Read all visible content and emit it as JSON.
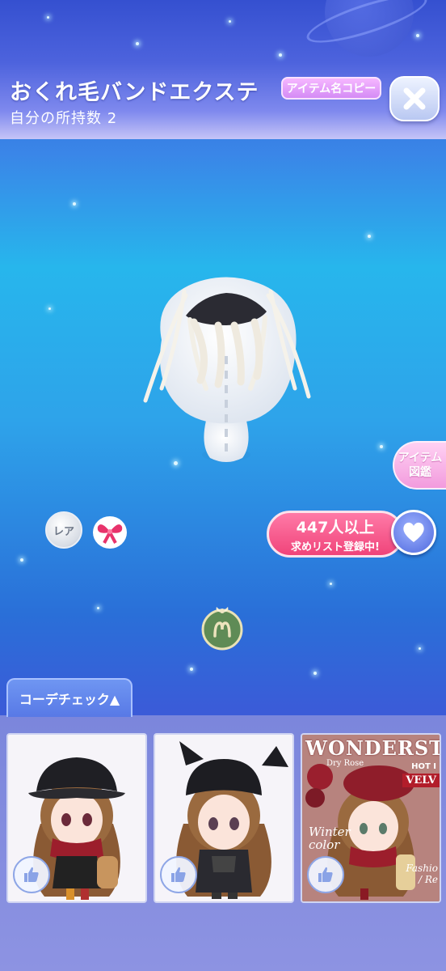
{
  "header": {
    "item_name": "おくれ毛バンドエクステ",
    "owned_count": "自分の所持数 2",
    "copy_label": "アイテム名コピー"
  },
  "side": {
    "zukan_label_line1": "アイテム",
    "zukan_label_line2": "図鑑"
  },
  "badges": {
    "rarity": "レア"
  },
  "wishlist": {
    "count": "447人以上",
    "label": "求めリスト登録中!"
  },
  "coordinate": {
    "tab_label": "コーデチェック▲",
    "cards": [
      {
        "hat": "bucket-hat"
      },
      {
        "hat": "cat-ear-hood"
      },
      {
        "hat": "beret",
        "magazine_title": "WONDERSTYL",
        "magazine_sub": "Dry Rose",
        "magazine_hot": "HOT I",
        "magazine_velv": "VELV",
        "magazine_winter": "Winter\ncolor",
        "magazine_fashion": "Fashio\n/ Re"
      }
    ]
  },
  "colors": {
    "accent_pink": "#f0447a",
    "header_blue": "#3550d0",
    "panel_purple": "#7b86dc"
  }
}
